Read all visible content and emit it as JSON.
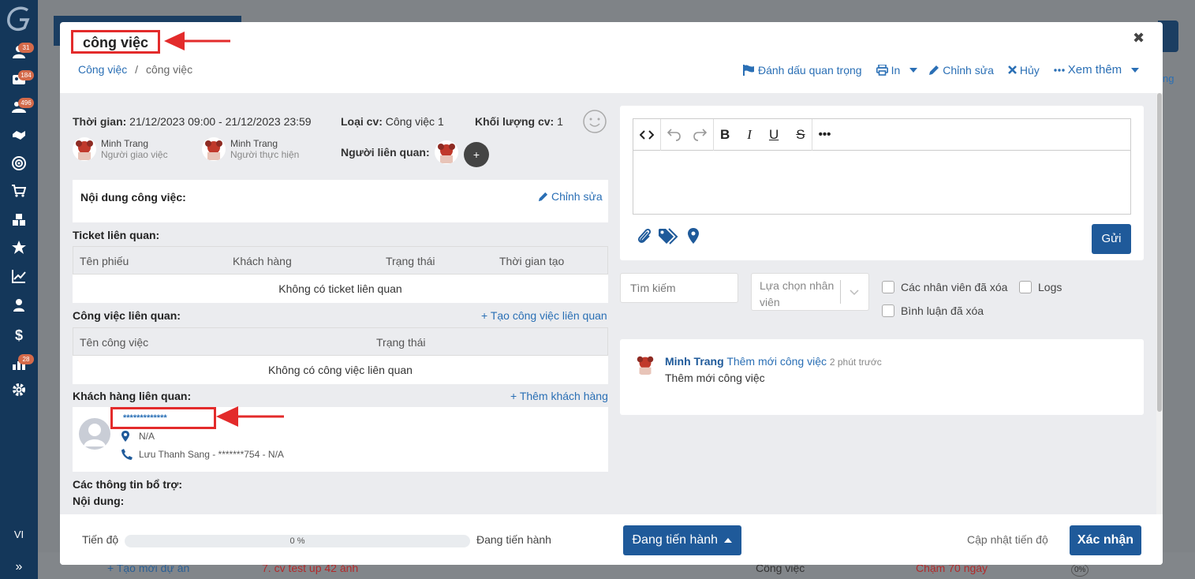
{
  "sidebar": {
    "logo": "G",
    "badges": [
      "31",
      "184",
      "496",
      "28"
    ],
    "icons": [
      "user-icon",
      "id-card-icon",
      "users-icon",
      "handshake-icon",
      "target-icon",
      "cart-icon",
      "cubes-icon",
      "star-icon",
      "chart-line-icon",
      "sitemap-icon",
      "dollar-icon",
      "team-icon",
      "gear-icon"
    ],
    "lang": "VI",
    "expand": "»"
  },
  "background": {
    "tab_text": "ng",
    "bottom_left": "+ Tạo mới dự án",
    "bottom_task": "7. cv test up 42 ảnh",
    "bottom_type": "Công việc",
    "bottom_late": "Chậm 70 ngày",
    "bottom_pct": "0%"
  },
  "modal": {
    "title": "công việc",
    "close": "✖",
    "breadcrumb": {
      "parent": "Công việc",
      "sep": "/",
      "current": "công việc"
    },
    "toolbar": {
      "mark_important": "Đánh dấu quan trọng",
      "print": "In",
      "edit": "Chỉnh sửa",
      "cancel": "Hủy",
      "more": "Xem thêm"
    },
    "info": {
      "time_label": "Thời gian:",
      "time_value": "21/12/2023 09:00 - 21/12/2023 23:59",
      "type_label": "Loại cv:",
      "type_value": "Công việc 1",
      "volume_label": "Khối lượng cv:",
      "volume_value": "1",
      "assigner_name": "Minh Trang",
      "assigner_role": "Người giao việc",
      "assignee_name": "Minh Trang",
      "assignee_role": "Người thực hiện",
      "related_people_label": "Người liên quan:",
      "plus": "+"
    },
    "content": {
      "label": "Nội dung công việc:",
      "edit": "Chỉnh sửa"
    },
    "tickets": {
      "label": "Ticket liên quan:",
      "columns": [
        "Tên phiếu",
        "Khách hàng",
        "Trạng thái",
        "Thời gian tạo"
      ],
      "empty": "Không có ticket liên quan"
    },
    "related_tasks": {
      "label": "Công việc liên quan:",
      "add": "+ Tạo công việc liên quan",
      "columns": [
        "Tên công việc",
        "Trạng thái"
      ],
      "empty": "Không có công việc liên quan"
    },
    "customers": {
      "label": "Khách hàng liên quan:",
      "add": "+ Thêm khách hàng",
      "name": "*************",
      "address": "N/A",
      "phone": "Lưu Thanh Sang - *******754 - N/A"
    },
    "extra": {
      "label": "Các thông tin bổ trợ:",
      "content_label": "Nội dung:"
    },
    "comment": {
      "send": "Gửi"
    },
    "filters": {
      "search_placeholder": "Tìm kiếm",
      "select_placeholder": "Lựa chọn nhân viên",
      "deleted_staff": "Các nhân viên đã xóa",
      "logs": "Logs",
      "deleted_comments": "Bình luận đã xóa"
    },
    "activity": {
      "user": "Minh Trang",
      "action": "Thêm mới công việc",
      "time": "2 phút trước",
      "text": "Thêm mới công việc"
    },
    "footer": {
      "progress_label": "Tiến độ",
      "progress": 0,
      "progress_text": "0 %",
      "status": "Đang tiến hành",
      "status_button": "Đang tiến hành",
      "update_progress": "Cập nhật tiến độ",
      "confirm": "Xác nhận"
    }
  },
  "colors": {
    "primary": "#1f5a9a",
    "link": "#2a6fb5",
    "sidebar": "#14375a",
    "annotation": "#e32b2b"
  }
}
